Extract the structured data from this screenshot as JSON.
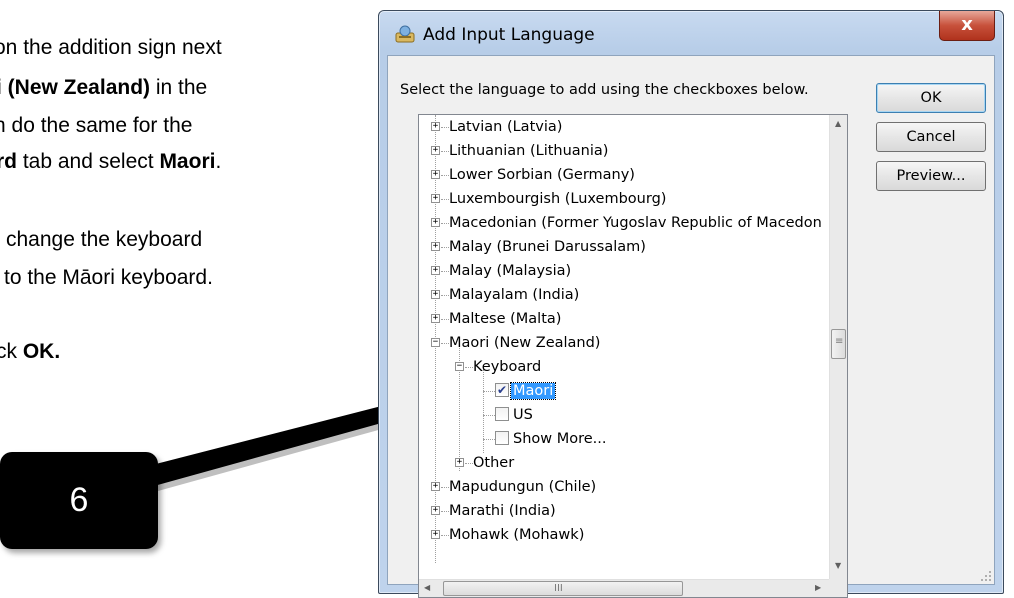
{
  "instructions": {
    "line1": "on the addition sign next",
    "line2_bold": "i (New Zealand)",
    "line2_rest": " in the",
    "line3": "n do the same for the",
    "line4_bold_a": "rd",
    "line4_mid": " tab and select ",
    "line4_bold_b": "Maori",
    "line4_end": ".",
    "line5": "change the keyboard",
    "line6": "to the Māori keyboard.",
    "line7_pre": "ck ",
    "line7_bold": "OK."
  },
  "callout": {
    "label": "6"
  },
  "dialog": {
    "title": "Add Input Language",
    "close_label": "x",
    "instruction": "Select the language to add using the checkboxes below.",
    "buttons": {
      "ok": "OK",
      "cancel": "Cancel",
      "preview": "Preview..."
    },
    "tree": {
      "items": [
        "Latvian (Latvia)",
        "Lithuanian (Lithuania)",
        "Lower Sorbian (Germany)",
        "Luxembourgish (Luxembourg)",
        "Macedonian (Former Yugoslav Republic of Macedon",
        "Malay (Brunei Darussalam)",
        "Malay (Malaysia)",
        "Malayalam (India)",
        "Maltese (Malta)",
        "Maori (New Zealand)",
        "Keyboard",
        "Maori",
        "US",
        "Show More...",
        "Other",
        "Mapudungun (Chile)",
        "Marathi (India)",
        "Mohawk (Mohawk)"
      ],
      "checked": {
        "maori": true,
        "us": false,
        "show_more": false
      }
    },
    "hscroll_grip": "III",
    "vscroll_grip": "≡"
  }
}
